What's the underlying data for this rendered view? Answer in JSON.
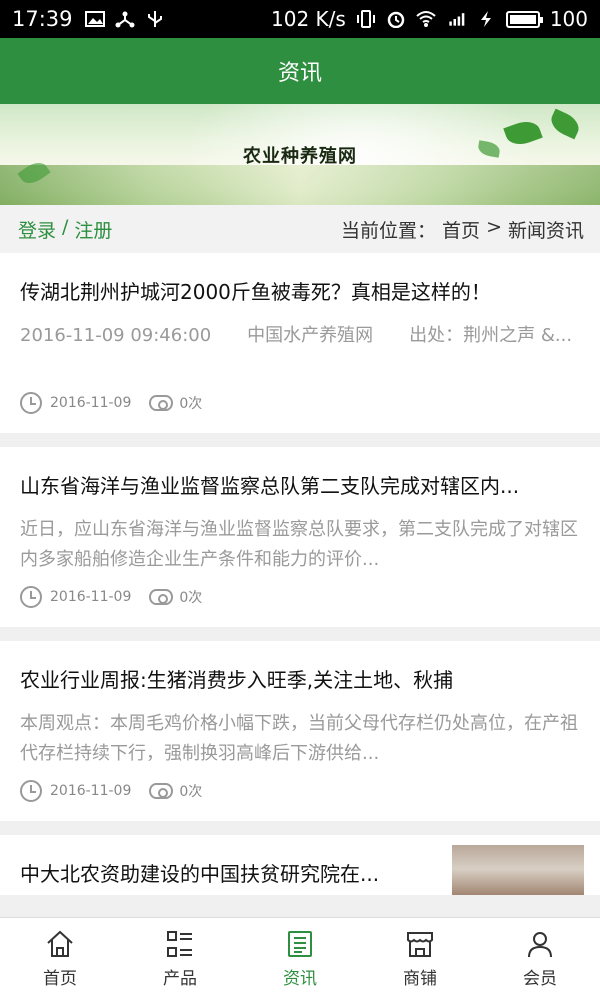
{
  "status_bar": {
    "time": "17:39",
    "speed": "102 K/s",
    "battery": "100",
    "icons": [
      "image-icon",
      "share-icon",
      "usb-icon",
      "vibrate-icon",
      "alarm-icon",
      "wifi-icon",
      "signal-4g-icon",
      "charging-icon",
      "battery-icon"
    ]
  },
  "header": {
    "title": "资讯"
  },
  "banner": {
    "title": "农业种养殖网"
  },
  "location_bar": {
    "login": "登录",
    "separator": "/",
    "register": "注册",
    "breadcrumb_label": "当前位置：",
    "home": "首页",
    "arrow": ">",
    "current": "新闻资讯"
  },
  "articles": [
    {
      "title": "传湖北荆州护城河2000斤鱼被毒死？真相是这样的！",
      "summary": "2016-11-09 09:46:00　　中国水产养殖网　　出处：荆州之声 &...",
      "date": "2016-11-09",
      "views": "0次"
    },
    {
      "title": "山东省海洋与渔业监督监察总队第二支队完成对辖区内...",
      "summary": "近日，应山东省海洋与渔业监督监察总队要求，第二支队完成了对辖区内多家船舶修造企业生产条件和能力的评价...",
      "date": "2016-11-09",
      "views": "0次"
    },
    {
      "title": "农业行业周报:生猪消费步入旺季,关注土地、秋捕",
      "summary": "本周观点：本周毛鸡价格小幅下跌，当前父母代存栏仍处高位，在产祖代存栏持续下行，强制换羽高峰后下游供给...",
      "date": "2016-11-09",
      "views": "0次"
    },
    {
      "title": "中大北农资助建设的中国扶贫研究院在..."
    }
  ],
  "bottom_nav": {
    "active": "资讯",
    "items": [
      {
        "label": "首页",
        "icon": "home-icon"
      },
      {
        "label": "产品",
        "icon": "list-icon"
      },
      {
        "label": "资讯",
        "icon": "news-icon"
      },
      {
        "label": "商铺",
        "icon": "shop-icon"
      },
      {
        "label": "会员",
        "icon": "user-icon"
      }
    ]
  },
  "colors": {
    "primary": "#2d8f3f",
    "muted_text": "#9a9a9a"
  }
}
